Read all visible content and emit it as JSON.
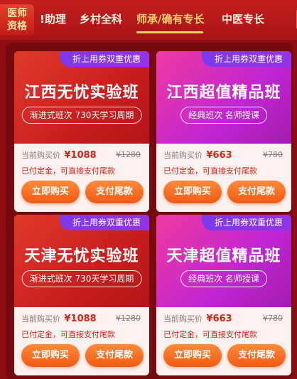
{
  "header": {
    "badge_line1": "医师",
    "badge_line2": "资格",
    "tabs": [
      {
        "label": "!助理"
      },
      {
        "label": "乡村全科"
      },
      {
        "label": "师承/确有专长",
        "active": true
      },
      {
        "label": "中医专长"
      }
    ]
  },
  "colors": {
    "accent": "#ffd36b",
    "price": "#d4241c",
    "button": "#f25a14"
  },
  "cards": [
    {
      "ribbon": "折上用券双重优惠",
      "title": "江西无忧实验班",
      "subtitle": "渐进式班次 730天学习周期",
      "price_label": "当前购买价",
      "price": "¥1088",
      "original_price": "¥1280",
      "note": "已付定金，可直接支付尾款",
      "btn_buy": "立即购买",
      "btn_balance": "支付尾款"
    },
    {
      "ribbon": "折上用券双重优惠",
      "title": "江西超值精品班",
      "subtitle": "经典班次 名师授课",
      "price_label": "当前购买价",
      "price": "¥663",
      "original_price": "¥780",
      "note": "已付定金，可直接支付尾款",
      "btn_buy": "立即购买",
      "btn_balance": "支付尾款"
    },
    {
      "ribbon": "折上用券双重优惠",
      "title": "天津无忧实验班",
      "subtitle": "渐进式班次 730天学习周期",
      "price_label": "当前购买价",
      "price": "¥1088",
      "original_price": "¥1280",
      "note": "已付定金，可直接支付尾款",
      "btn_buy": "立即购买",
      "btn_balance": "支付尾款"
    },
    {
      "ribbon": "折上用券双重优惠",
      "title": "天津超值精品班",
      "subtitle": "经典班次 名师授课",
      "price_label": "当前购买价",
      "price": "¥663",
      "original_price": "¥780",
      "note": "已付定金，可直接支付尾款",
      "btn_buy": "立即购买",
      "btn_balance": "支付尾款"
    }
  ]
}
